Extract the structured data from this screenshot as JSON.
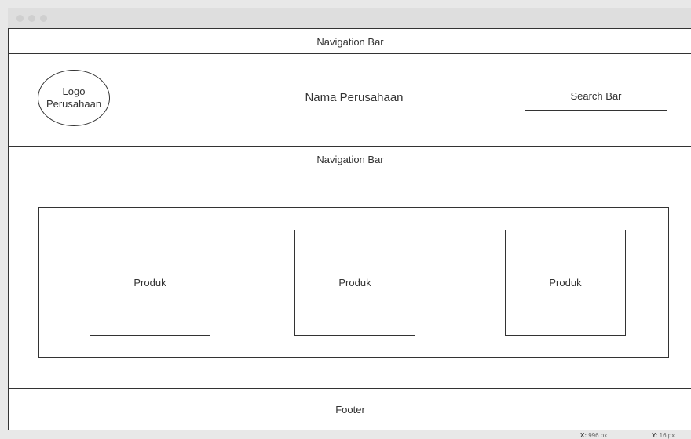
{
  "header_nav": {
    "label": "Navigation Bar"
  },
  "brand": {
    "logo_line1": "Logo",
    "logo_line2": "Perusahaan",
    "company_name": "Nama Perusahaan"
  },
  "search": {
    "label": "Search Bar"
  },
  "main_nav": {
    "label": "Navigation Bar"
  },
  "products": [
    {
      "label": "Produk"
    },
    {
      "label": "Produk"
    },
    {
      "label": "Produk"
    }
  ],
  "footer": {
    "label": "Footer"
  },
  "status_bar": {
    "x_label": "X:",
    "x_value": "996 px",
    "y_label": "Y:",
    "y_value": "16 px"
  }
}
